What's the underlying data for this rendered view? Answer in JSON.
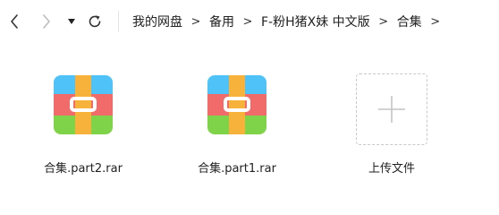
{
  "toolbar": {
    "back_icon": "chevron-left-icon",
    "forward_icon": "chevron-right-icon",
    "dropdown_icon": "caret-down-icon",
    "refresh_icon": "refresh-icon"
  },
  "breadcrumb": {
    "items": [
      "我的网盘",
      "备用",
      "F-粉H猪X妹 中文版",
      "合集"
    ],
    "separator": ">"
  },
  "files": [
    {
      "name": "合集.part2.rar",
      "icon": "archive-rar-icon"
    },
    {
      "name": "合集.part1.rar",
      "icon": "archive-rar-icon"
    }
  ],
  "upload": {
    "label": "上传文件",
    "icon": "plus-icon"
  },
  "colors": {
    "rar_top": "#4fc3f7",
    "rar_middle": "#f26b6b",
    "rar_bottom": "#7ed348",
    "rar_strap": "#f7b23b"
  }
}
